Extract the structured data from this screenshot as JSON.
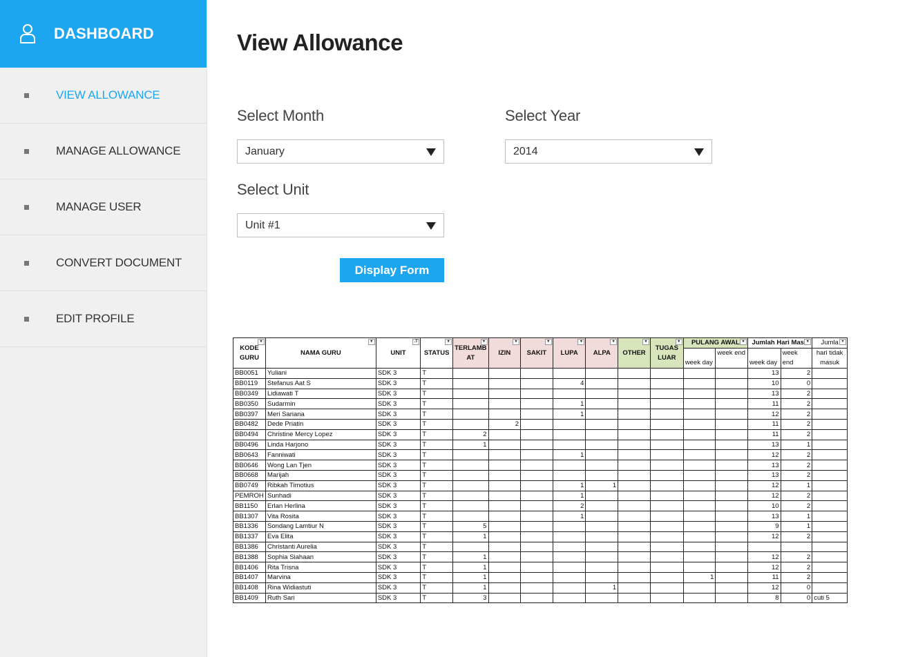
{
  "sidebar": {
    "brand": "DASHBOARD",
    "items": [
      {
        "label": "VIEW ALLOWANCE",
        "active": true
      },
      {
        "label": "MANAGE ALLOWANCE",
        "active": false
      },
      {
        "label": "MANAGE USER",
        "active": false
      },
      {
        "label": "CONVERT DOCUMENT",
        "active": false
      },
      {
        "label": "EDIT PROFILE",
        "active": false
      }
    ]
  },
  "main": {
    "title": "View Allowance",
    "month": {
      "label": "Select Month",
      "value": "January"
    },
    "year": {
      "label": "Select Year",
      "value": "2014"
    },
    "unit": {
      "label": "Select Unit",
      "value": "Unit #1"
    },
    "display_button": "Display Form"
  },
  "colors": {
    "accent": "#1da6f0",
    "sidebar_bg": "#f0f0f0",
    "pink_header": "#f2dcdb",
    "green_header": "#d8e4bc"
  },
  "sheet": {
    "headers": {
      "kode": "KODE GURU",
      "nama": "NAMA GURU",
      "unit": "UNIT",
      "status": "STATUS",
      "terlambat": "TERLAMB AT",
      "izin": "IZIN",
      "sakit": "SAKIT",
      "lupa": "LUPA",
      "alpa": "ALPA",
      "other": "OTHER",
      "tugas": "TUGAS LUAR",
      "pulang": "PULANG AWAL",
      "jumlah": "Jumlah Hari Masu",
      "jumla": "Jumla",
      "weekday1": "week day",
      "weekend1": "week end",
      "weekday2": "week day",
      "weekend2": "week end",
      "tidak": "hari tidak masuk"
    },
    "rows": [
      [
        "BB0051",
        "Yuliani",
        "SDK 3",
        "T",
        "",
        "",
        "",
        "",
        "",
        "",
        "",
        "",
        "",
        "13",
        "2",
        ""
      ],
      [
        "BB0119",
        "Stefanus Aat S",
        "SDK 3",
        "T",
        "",
        "",
        "",
        "4",
        "",
        "",
        "",
        "",
        "",
        "10",
        "0",
        ""
      ],
      [
        "BB0349",
        "Lidiawati T",
        "SDK 3",
        "T",
        "",
        "",
        "",
        "",
        "",
        "",
        "",
        "",
        "",
        "13",
        "2",
        ""
      ],
      [
        "BB0350",
        "Sudarmin",
        "SDK 3",
        "T",
        "",
        "",
        "",
        "1",
        "",
        "",
        "",
        "",
        "",
        "11",
        "2",
        ""
      ],
      [
        "BB0397",
        "Meri Sariana",
        "SDK 3",
        "T",
        "",
        "",
        "",
        "1",
        "",
        "",
        "",
        "",
        "",
        "12",
        "2",
        ""
      ],
      [
        "BB0482",
        "Dede Priatin",
        "SDK 3",
        "T",
        "",
        "2",
        "",
        "",
        "",
        "",
        "",
        "",
        "",
        "11",
        "2",
        ""
      ],
      [
        "BB0494",
        "Christine Mercy Lopez",
        "SDK 3",
        "T",
        "2",
        "",
        "",
        "",
        "",
        "",
        "",
        "",
        "",
        "11",
        "2",
        ""
      ],
      [
        "BB0496",
        "Linda Harjono",
        "SDK 3",
        "T",
        "1",
        "",
        "",
        "",
        "",
        "",
        "",
        "",
        "",
        "13",
        "1",
        ""
      ],
      [
        "BB0643",
        "Fanniwati",
        "SDK 3",
        "T",
        "",
        "",
        "",
        "1",
        "",
        "",
        "",
        "",
        "",
        "12",
        "2",
        ""
      ],
      [
        "BB0646",
        "Wong Lan Tjen",
        "SDK 3",
        "T",
        "",
        "",
        "",
        "",
        "",
        "",
        "",
        "",
        "",
        "13",
        "2",
        ""
      ],
      [
        "BB0668",
        "Marijah",
        "SDK 3",
        "T",
        "",
        "",
        "",
        "",
        "",
        "",
        "",
        "",
        "",
        "13",
        "2",
        ""
      ],
      [
        "BB0749",
        "Ribkah Timotius",
        "SDK 3",
        "T",
        "",
        "",
        "",
        "1",
        "1",
        "",
        "",
        "",
        "",
        "12",
        "1",
        ""
      ],
      [
        "PEMROH",
        "Sunhadi",
        "SDK 3",
        "T",
        "",
        "",
        "",
        "1",
        "",
        "",
        "",
        "",
        "",
        "12",
        "2",
        ""
      ],
      [
        "BB1150",
        "Erlan Herlina",
        "SDK 3",
        "T",
        "",
        "",
        "",
        "2",
        "",
        "",
        "",
        "",
        "",
        "10",
        "2",
        ""
      ],
      [
        "BB1307",
        "Vita Rosita",
        "SDK 3",
        "T",
        "",
        "",
        "",
        "1",
        "",
        "",
        "",
        "",
        "",
        "13",
        "1",
        ""
      ],
      [
        "BB1336",
        "Sondang Lamtiur N",
        "SDK 3",
        "T",
        "5",
        "",
        "",
        "",
        "",
        "",
        "",
        "",
        "",
        "9",
        "1",
        ""
      ],
      [
        "BB1337",
        "Eva Elita",
        "SDK 3",
        "T",
        "1",
        "",
        "",
        "",
        "",
        "",
        "",
        "",
        "",
        "12",
        "2",
        ""
      ],
      [
        "BB1386",
        "Christanti Aurelia",
        "SDK 3",
        "T",
        "",
        "",
        "",
        "",
        "",
        "",
        "",
        "",
        "",
        "",
        "",
        ""
      ],
      [
        "BB1388",
        "Sophia Siahaan",
        "SDK 3",
        "T",
        "1",
        "",
        "",
        "",
        "",
        "",
        "",
        "",
        "",
        "12",
        "2",
        ""
      ],
      [
        "BB1406",
        "Rita Trisna",
        "SDK 3",
        "T",
        "1",
        "",
        "",
        "",
        "",
        "",
        "",
        "",
        "",
        "12",
        "2",
        ""
      ],
      [
        "BB1407",
        "Marvina",
        "SDK 3",
        "T",
        "1",
        "",
        "",
        "",
        "",
        "",
        "",
        "1",
        "",
        "11",
        "2",
        ""
      ],
      [
        "BB1408",
        "Rina Widiastuti",
        "SDK 3",
        "T",
        "1",
        "",
        "",
        "",
        "1",
        "",
        "",
        "",
        "",
        "12",
        "0",
        ""
      ],
      [
        "BB1409",
        "Ruth Sari",
        "SDK 3",
        "T",
        "3",
        "",
        "",
        "",
        "",
        "",
        "",
        "",
        "",
        "8",
        "0",
        "cuti 5"
      ]
    ]
  }
}
